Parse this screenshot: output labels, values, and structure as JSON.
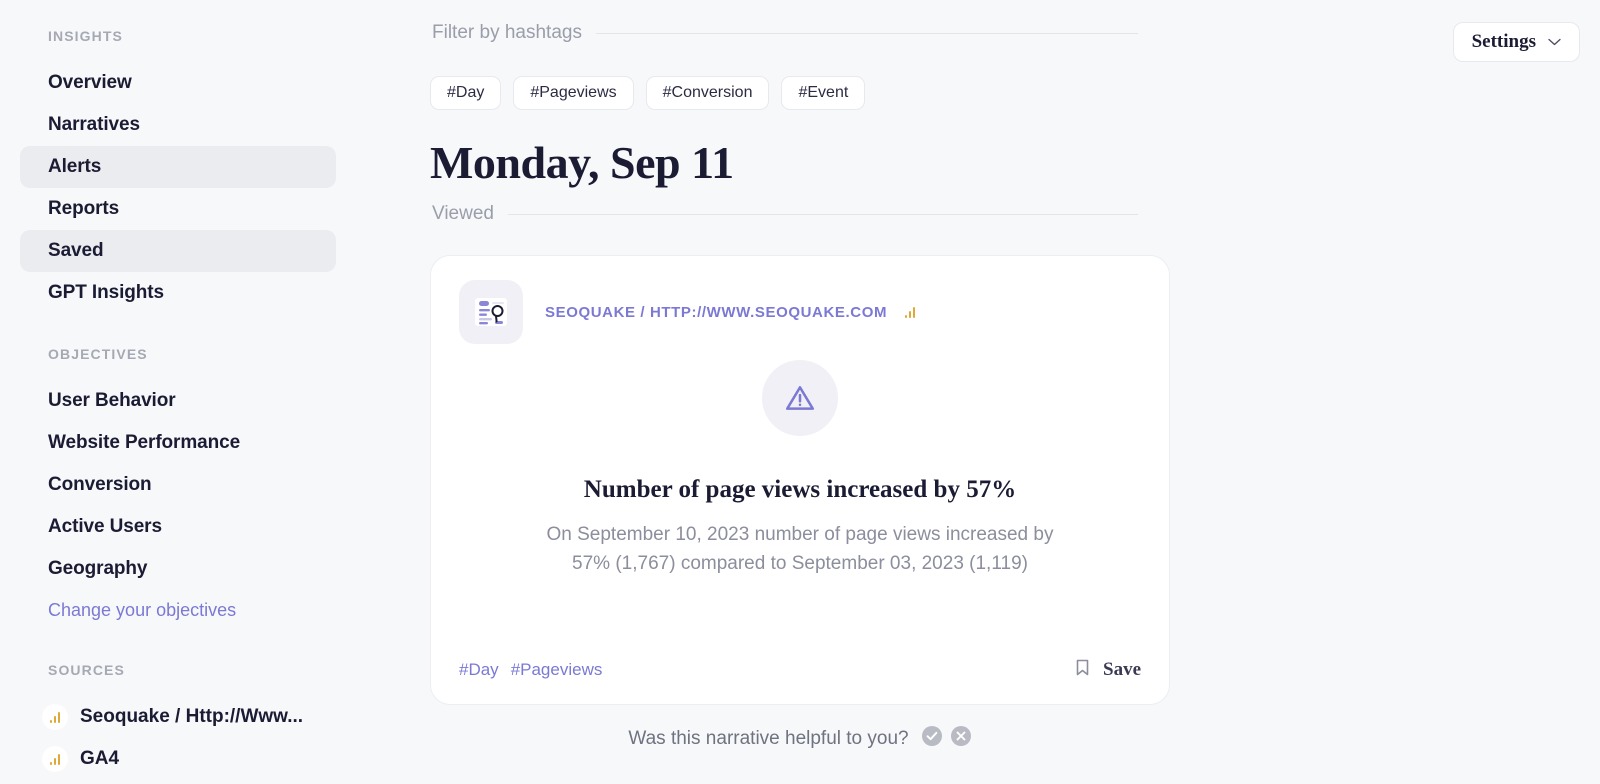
{
  "sidebar": {
    "groups": [
      {
        "title": "INSIGHTS",
        "items": [
          {
            "label": "Overview",
            "active": false
          },
          {
            "label": "Narratives",
            "active": false
          },
          {
            "label": "Alerts",
            "active": true
          },
          {
            "label": "Reports",
            "active": false
          },
          {
            "label": "Saved",
            "active": true
          },
          {
            "label": "GPT Insights",
            "active": false
          }
        ]
      },
      {
        "title": "OBJECTIVES",
        "items": [
          {
            "label": "User Behavior",
            "active": false
          },
          {
            "label": "Website Performance",
            "active": false
          },
          {
            "label": "Conversion",
            "active": false
          },
          {
            "label": "Active Users",
            "active": false
          },
          {
            "label": "Geography",
            "active": false
          }
        ],
        "link": "Change your objectives"
      }
    ],
    "sources_title": "SOURCES",
    "sources": [
      {
        "label": "Seoquake / Http://Www...",
        "icon": "bar-chart-icon"
      },
      {
        "label": "GA4",
        "icon": "bar-chart-icon"
      }
    ]
  },
  "header": {
    "filter_label": "Filter by hashtags",
    "hashtags": [
      "#Day",
      "#Pageviews",
      "#Conversion",
      "#Event"
    ],
    "settings_label": "Settings",
    "settings_icon": "chevron-down-icon"
  },
  "day": {
    "title": "Monday, Sep 11",
    "status_label": "Viewed"
  },
  "card": {
    "logo_icon": "seoquake-document-icon",
    "source": "SEOQUAKE / HTTP://WWW.SEOQUAKE.COM",
    "source_icon": "bar-chart-icon",
    "alert_icon": "warning-triangle-icon",
    "title": "Number of page views increased by 57%",
    "description": "On September 10, 2023 number of page views increased by 57% (1,767) compared to September 03, 2023 (1,119)",
    "tags": [
      "#Day",
      "#Pageviews"
    ],
    "save_label": "Save",
    "save_icon": "bookmark-icon"
  },
  "feedback": {
    "question": "Was this narrative helpful to you?",
    "yes_icon": "check-circle-icon",
    "no_icon": "x-circle-icon"
  },
  "colors": {
    "background": "#f7f8fa",
    "accent_purple": "#7b79d4",
    "text_dark": "#1b1c34",
    "text_muted": "#8b8e9c",
    "source_amber": "#e0a838",
    "active_row": "#ebecf0"
  }
}
